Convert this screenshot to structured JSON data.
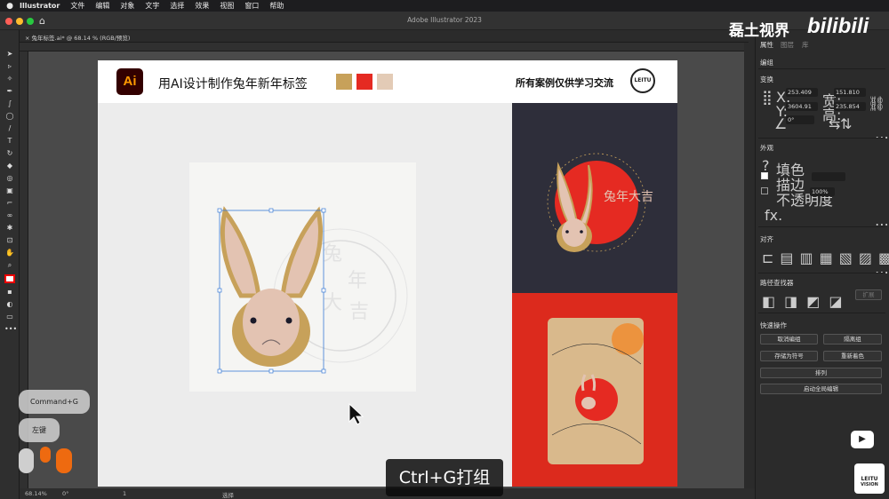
{
  "menubar": {
    "apple": "",
    "app": "Illustrator",
    "items": [
      "文件",
      "编辑",
      "对象",
      "文字",
      "选择",
      "效果",
      "视图",
      "窗口",
      "帮助"
    ]
  },
  "window": {
    "title": "Adobe Illustrator 2023"
  },
  "doc_tab": {
    "label": "兔年标签.ai* @ 68.14 % (RGB/预览)",
    "close": "×"
  },
  "header": {
    "logo": "Ai",
    "title": "用AI设计制作兔年新年标签",
    "right_text": "所有案例仅供学习交流",
    "brand_logo": "LEITU",
    "swatches": [
      "#c7a15a",
      "#e52a22",
      "#e3cbb6"
    ]
  },
  "artwork": {
    "ring_text": "HAPPY CHINESE NEW YEAR",
    "seal_text": "兔年大吉"
  },
  "right_panel": {
    "tabs": [
      "属性",
      "图层",
      "库"
    ],
    "group_label": "编组",
    "transform": {
      "label": "变换",
      "x_label": "X:",
      "x": "253.409",
      "w_label": "宽:",
      "w": "151.810",
      "y_label": "Y:",
      "y": "3604.91",
      "h_label": "高:",
      "h": "235.854",
      "angle": "0°"
    },
    "appearance": {
      "label": "外观",
      "fill": "填色",
      "stroke": "描边",
      "opacity_label": "不透明度",
      "opacity": "100%",
      "fx": "fx."
    },
    "align": {
      "label": "对齐"
    },
    "pathfinder": {
      "label": "路径查找器",
      "expand": "扩展"
    },
    "quick": {
      "label": "快速操作",
      "ungroup": "取消编组",
      "isolate": "隔离组",
      "save_symbol": "存储为符号",
      "recolor": "重新着色",
      "arrange": "排列",
      "global_edit": "启动全局编辑"
    }
  },
  "status": {
    "zoom": "68.14%",
    "angle": "0°",
    "page": "1",
    "mode": "选择"
  },
  "overlay": {
    "shortcut": "Command+G",
    "mouse": "左键",
    "caption": "Ctrl+G打组",
    "watermark_cn": "磊土视界",
    "watermark_en": "bilibili",
    "corner_logo": "LEITU",
    "corner_sub": "VISION"
  }
}
